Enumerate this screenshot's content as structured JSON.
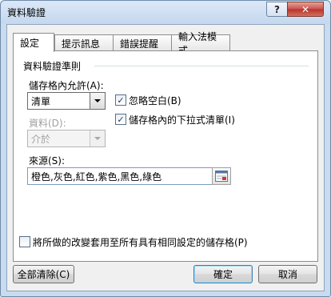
{
  "window": {
    "title": "資料驗證",
    "help_label": "?",
    "close_label": "✕"
  },
  "tabs": [
    {
      "label": "設定"
    },
    {
      "label": "提示訊息"
    },
    {
      "label": "錯誤提醒"
    },
    {
      "label": "輸入法模式"
    }
  ],
  "criteria": {
    "group_label": "資料驗證準則",
    "allow_label": "儲存格內允許(A):",
    "allow_value": "清單",
    "data_label": "資料(D):",
    "data_value": "介於",
    "ignore_blank_label": "忽略空白(B)",
    "ignore_blank_checked": true,
    "in_cell_dropdown_label": "儲存格內的下拉式清單(I)",
    "in_cell_dropdown_checked": true,
    "source_label": "來源(S):",
    "source_value": "橙色,灰色,紅色,紫色,黑色,綠色"
  },
  "apply_all": {
    "label": "將所做的改變套用至所有具有相同設定的儲存格(P)",
    "checked": false
  },
  "buttons": {
    "clear_all": "全部清除(C)",
    "ok": "確定",
    "cancel": "取消"
  }
}
